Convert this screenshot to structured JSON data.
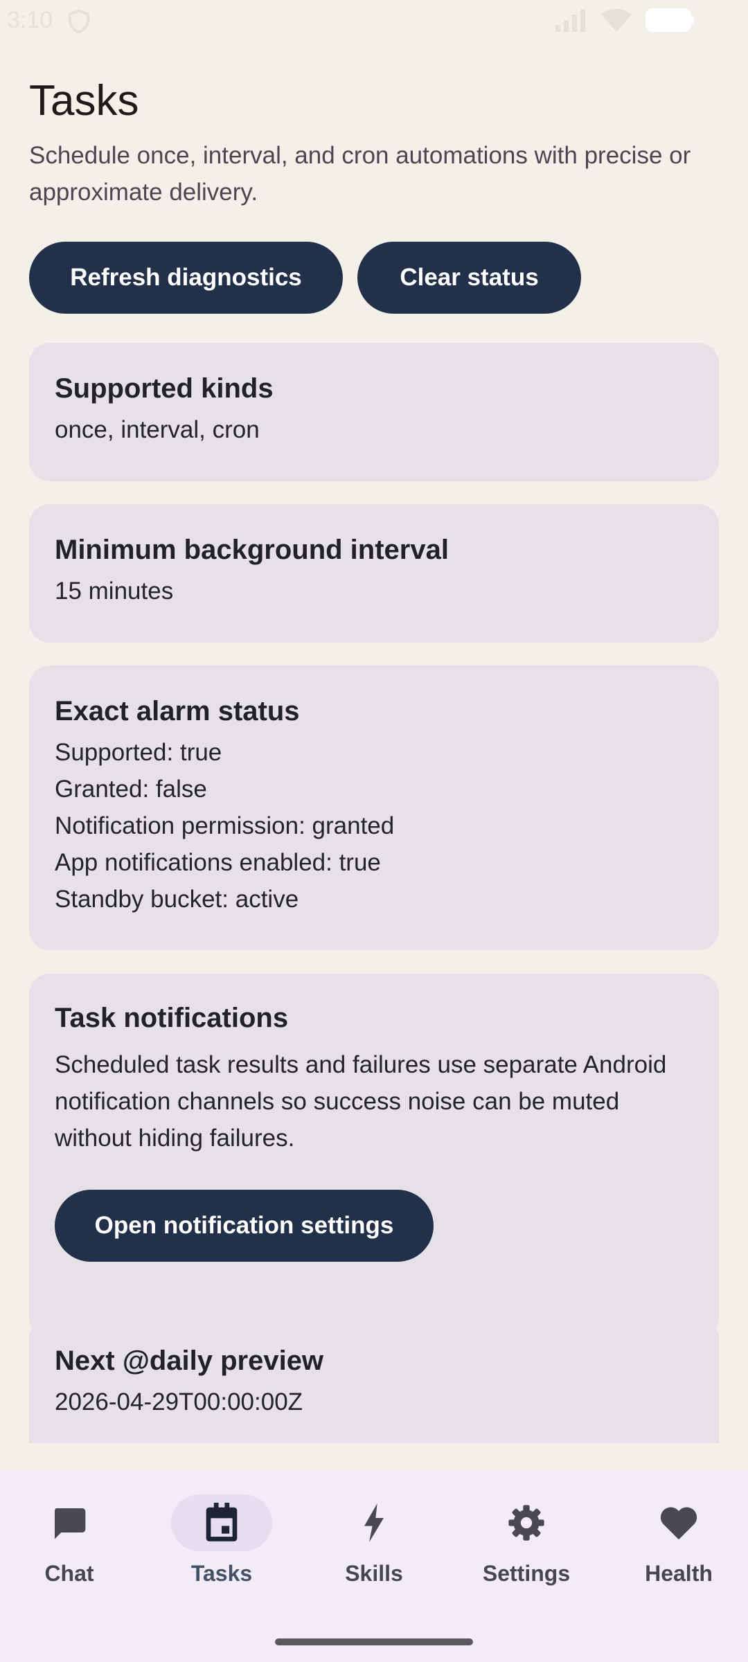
{
  "status_bar": {
    "time": "3:10"
  },
  "header": {
    "title": "Tasks",
    "subtitle": "Schedule once, interval, and cron automations with precise or approximate delivery."
  },
  "actions": {
    "refresh_label": "Refresh diagnostics",
    "clear_label": "Clear status"
  },
  "cards": {
    "supported_kinds": {
      "title": "Supported kinds",
      "body": "once, interval, cron"
    },
    "min_interval": {
      "title": "Minimum background interval",
      "body": "15 minutes"
    },
    "exact_alarm": {
      "title": "Exact alarm status",
      "lines": [
        "Supported: true",
        "Granted: false",
        "Notification permission: granted",
        "App notifications enabled: true",
        "Standby bucket: active"
      ]
    },
    "task_notifications": {
      "title": "Task notifications",
      "body": "Scheduled task results and failures use separate Android notification channels so success noise can be muted without hiding failures.",
      "button_label": "Open notification settings"
    },
    "daily_preview": {
      "title": "Next @daily preview",
      "body": "2026-04-29T00:00:00Z"
    }
  },
  "nav": {
    "items": [
      {
        "label": "Chat",
        "icon": "chat-icon"
      },
      {
        "label": "Tasks",
        "icon": "calendar-icon",
        "active": true
      },
      {
        "label": "Skills",
        "icon": "bolt-icon"
      },
      {
        "label": "Settings",
        "icon": "gear-icon"
      },
      {
        "label": "Health",
        "icon": "heart-icon"
      }
    ]
  },
  "colors": {
    "background": "#f3efe9",
    "card": "#e5e1e6",
    "button": "#23304a",
    "nav_background": "#f1ecf7",
    "nav_active_pill": "#e5ddf0"
  }
}
